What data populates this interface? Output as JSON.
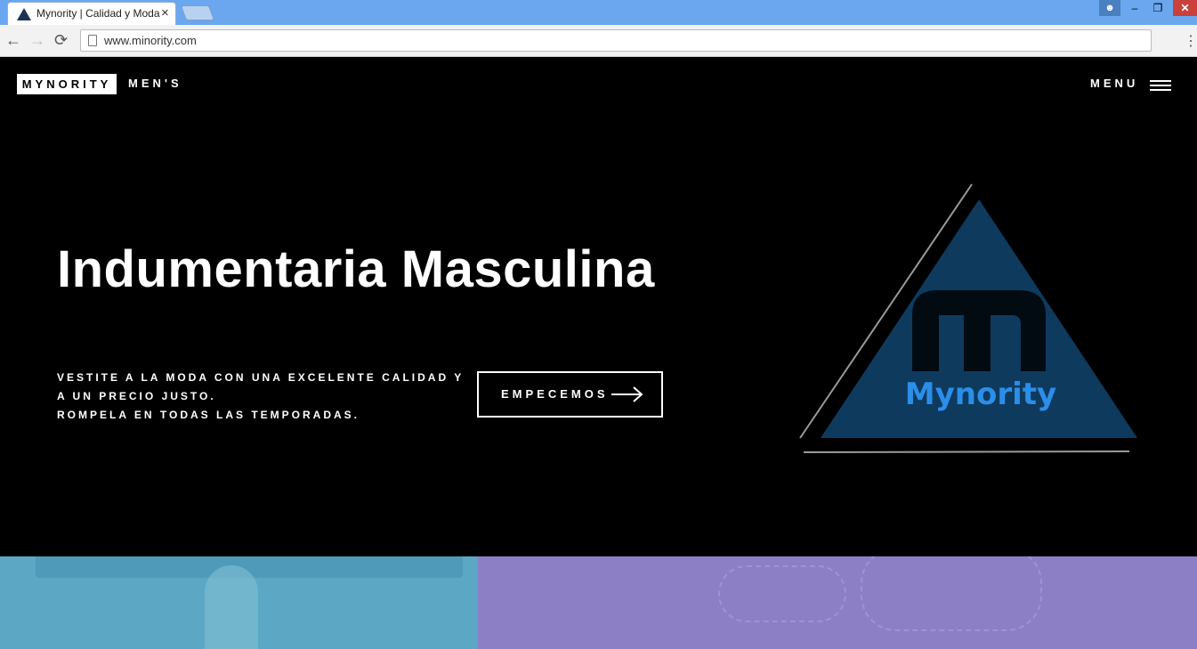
{
  "browser": {
    "tab_title": "Mynority | Calidad y Moda",
    "url": "www.minority.com",
    "window_controls": {
      "minimize": "‒",
      "maximize": "❐",
      "close": "✕"
    },
    "close_tab_icon": "×",
    "nav_icons": {
      "back": "←",
      "forward": "→",
      "reload": "⟳"
    }
  },
  "header": {
    "brand": "MYNORITY",
    "brand_sub": "MEN'S",
    "menu_label": "MENU"
  },
  "hero": {
    "title": "Indumentaria Masculina",
    "lines": [
      "VESTITE A LA MODA CON UNA EXCELENTE CALIDAD Y",
      "A UN PRECIO JUSTO.",
      "ROMPELA EN TODAS LAS TEMPORADAS."
    ],
    "cta_label": "EMPECEMOS",
    "logo_text": "Mynority"
  },
  "colors": {
    "logo_blue": "#0e3a5e",
    "logo_text": "#2b8ee8",
    "tile_left": "#5ba7c4",
    "tile_right": "#8c7fc6"
  }
}
